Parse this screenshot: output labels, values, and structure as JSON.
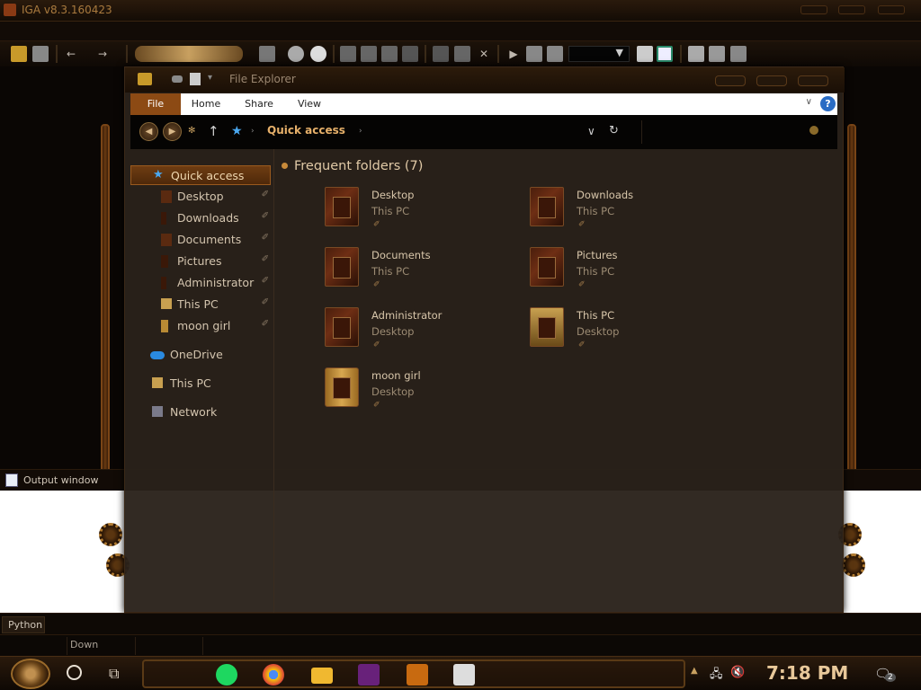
{
  "app": {
    "title": "IGA v8.3.160423"
  },
  "toolbar": {
    "combo_arrow": "▼"
  },
  "explorer": {
    "title": "File Explorer",
    "ribbon_tabs": [
      "File",
      "Home",
      "Share",
      "View"
    ],
    "help": "?",
    "address": "Quick access",
    "section_title": "Frequent folders (7)",
    "nav": [
      {
        "label": "Quick access",
        "indent": false
      },
      {
        "label": "Desktop",
        "indent": true
      },
      {
        "label": "Downloads",
        "indent": true
      },
      {
        "label": "Documents",
        "indent": true
      },
      {
        "label": "Pictures",
        "indent": true
      },
      {
        "label": "Administrator",
        "indent": true
      },
      {
        "label": "This PC",
        "indent": true
      },
      {
        "label": "moon girl",
        "indent": true
      },
      {
        "label": "OneDrive",
        "indent": false
      },
      {
        "label": "This PC",
        "indent": false
      },
      {
        "label": "Network",
        "indent": false
      }
    ],
    "folders": [
      {
        "name": "Desktop",
        "location": "This PC"
      },
      {
        "name": "Downloads",
        "location": "This PC"
      },
      {
        "name": "Documents",
        "location": "This PC"
      },
      {
        "name": "Pictures",
        "location": "This PC"
      },
      {
        "name": "Administrator",
        "location": "Desktop"
      },
      {
        "name": "This PC",
        "location": "Desktop"
      },
      {
        "name": "moon girl",
        "location": "Desktop"
      }
    ]
  },
  "output_window": {
    "label": "Output window"
  },
  "python_tab": "Python",
  "status": {
    "mode": "Down"
  },
  "taskbar": {
    "time": "7:18 PM",
    "notification_count": "2",
    "apps": [
      "spotify-icon",
      "chrome-icon",
      "file-explorer-icon",
      "visual-studio-icon",
      "adobe-dreamweaver-icon",
      "photo-viewer-icon"
    ]
  },
  "colors": {
    "accent": "#8c4a14",
    "text": "#d8c6aa",
    "muted": "#9c8b73",
    "clock": "#e8c89a"
  }
}
